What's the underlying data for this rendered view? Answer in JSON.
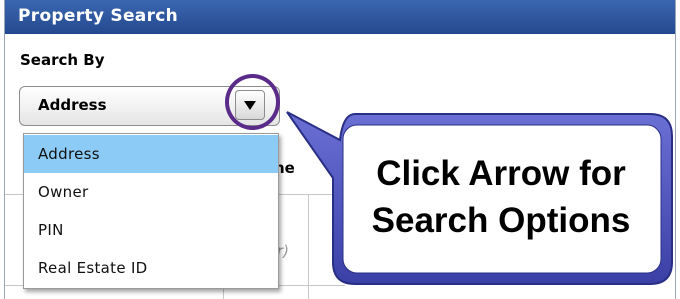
{
  "panel": {
    "title": "Property Search",
    "search_by_label": "Search By",
    "select": {
      "value": "Address",
      "arrow_icon": "dropdown-arrow-icon"
    },
    "dropdown": {
      "options": [
        "Address",
        "Owner",
        "PIN",
        "Real Estate ID"
      ],
      "selected_index": 0
    },
    "background_fragments": {
      "column_header": "ne",
      "hint": "r)"
    }
  },
  "callout": {
    "line1": "Click Arrow for",
    "line2": "Search Options"
  },
  "colors": {
    "titlebar": "#2f5aa0",
    "selected_option": "#8ccbf6",
    "highlight_ring": "#5b2b8a",
    "callout_fill": "#4a50b8"
  }
}
